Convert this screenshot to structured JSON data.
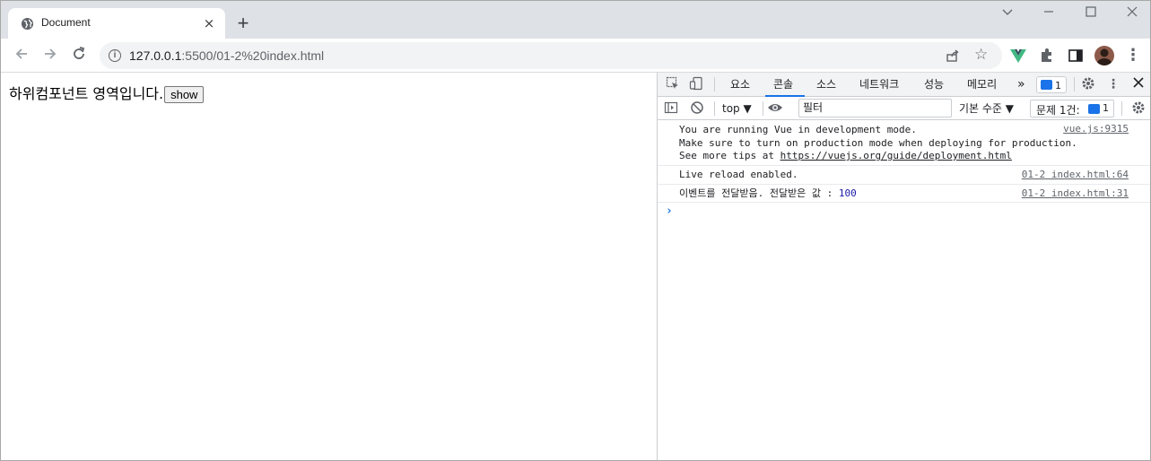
{
  "browser": {
    "tab_title": "Document",
    "tab_close": "×",
    "new_tab": "+",
    "url_host": "127.0.0.1",
    "url_path": ":5500/01-2%20index.html"
  },
  "page": {
    "text": "하위컴포넌트 영역입니다.",
    "button_label": "show"
  },
  "devtools": {
    "tabs": [
      "요소",
      "콘솔",
      "소스",
      "네트워크",
      "성능",
      "메모리"
    ],
    "active_tab": "콘솔",
    "more": "»",
    "badge_count": "1",
    "context": "top ▼",
    "filter_placeholder": "필터",
    "level": "기본 수준 ▼",
    "issues_label": "문제 1건:",
    "issues_count": "1",
    "console": {
      "vue_line1": "You are running Vue in development mode.",
      "vue_line2": "Make sure to turn on production mode when deploying for production.",
      "vue_line3_prefix": "See more tips at ",
      "vue_line3_link": "https://vuejs.org/guide/deployment.html",
      "vue_source": "vue.js:9315",
      "reload_text": "Live reload enabled.",
      "reload_source": "01-2 index.html:64",
      "event_text": "이벤트를 전달받음. 전달받은 값 : ",
      "event_value": "100",
      "event_source": "01-2 index.html:31",
      "prompt": "›"
    }
  },
  "colors": {
    "accent": "#1a73e8",
    "tabstrip": "#dee1e6",
    "vue_green": "#41b883"
  }
}
